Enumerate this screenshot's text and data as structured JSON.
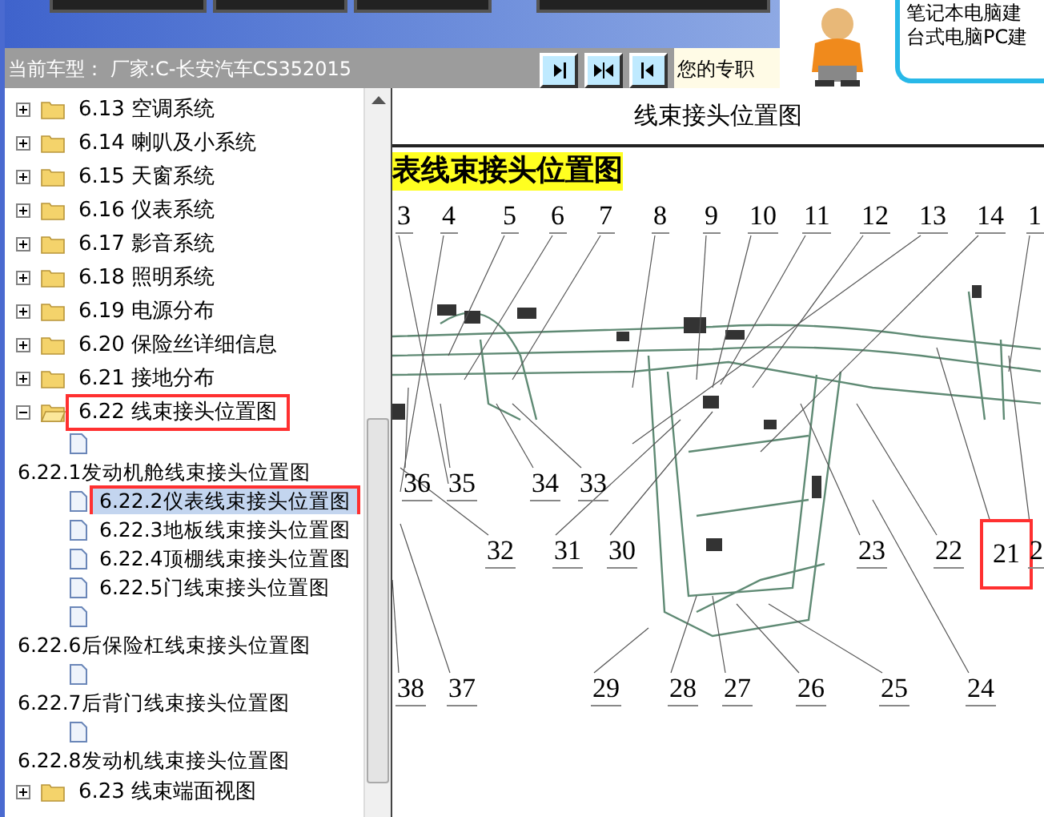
{
  "vehicle_bar": {
    "label": "当前车型：",
    "value": "厂家:C-长安汽车CS352015",
    "view_buttons": [
      {
        "kind": "right"
      },
      {
        "kind": "split"
      },
      {
        "kind": "left"
      }
    ],
    "notice": "您的专职"
  },
  "ad": {
    "lines": [
      "笔记本电脑建",
      "台式电脑PC建"
    ]
  },
  "tree": [
    {
      "kind": "folder",
      "label": "6.13 空调系统",
      "expanded": false,
      "annotated": false
    },
    {
      "kind": "folder",
      "label": "6.14 喇叭及小系统",
      "expanded": false,
      "annotated": false
    },
    {
      "kind": "folder",
      "label": "6.15 天窗系统",
      "expanded": false,
      "annotated": false
    },
    {
      "kind": "folder",
      "label": "6.16 仪表系统",
      "expanded": false,
      "annotated": false
    },
    {
      "kind": "folder",
      "label": "6.17 影音系统",
      "expanded": false,
      "annotated": false
    },
    {
      "kind": "folder",
      "label": "6.18 照明系统",
      "expanded": false,
      "annotated": false
    },
    {
      "kind": "folder",
      "label": "6.19 电源分布",
      "expanded": false,
      "annotated": false
    },
    {
      "kind": "folder",
      "label": "6.20 保险丝详细信息",
      "expanded": false,
      "annotated": false
    },
    {
      "kind": "folder",
      "label": "6.21 接地分布",
      "expanded": false,
      "annotated": false
    },
    {
      "kind": "folder",
      "label": "6.22 线束接头位置图",
      "expanded": true,
      "annotated": true,
      "children": [
        {
          "kind": "doc"
        },
        {
          "kind": "group",
          "label": "6.22.1发动机舱线束接头位置图",
          "children": [
            {
              "kind": "doc",
              "label": "6.22.2仪表线束接头位置图",
              "selected": true,
              "annotated": true
            },
            {
              "kind": "doc",
              "label": "6.22.3地板线束接头位置图",
              "selected": false,
              "annotated": false
            },
            {
              "kind": "doc",
              "label": "6.22.4顶棚线束接头位置图",
              "selected": false,
              "annotated": false
            },
            {
              "kind": "doc",
              "label": "6.22.5门线束接头位置图",
              "selected": false,
              "annotated": false
            },
            {
              "kind": "doc"
            }
          ]
        },
        {
          "kind": "group",
          "label": "6.22.6后保险杠线束接头位置图",
          "children": [
            {
              "kind": "doc"
            }
          ]
        },
        {
          "kind": "group",
          "label": "6.22.7后背门线束接头位置图",
          "children": [
            {
              "kind": "doc"
            }
          ]
        },
        {
          "kind": "group",
          "label": "6.22.8发动机线束接头位置图"
        }
      ]
    },
    {
      "kind": "folder",
      "label": "6.23 线束端面视图",
      "expanded": false,
      "annotated": false
    }
  ],
  "document": {
    "title": "线束接头位置图",
    "section_heading": "表线束接头位置图",
    "callouts": [
      {
        "label": "3",
        "marked": false
      },
      {
        "label": "4",
        "marked": false
      },
      {
        "label": "5",
        "marked": false
      },
      {
        "label": "6",
        "marked": false
      },
      {
        "label": "7",
        "marked": false
      },
      {
        "label": "8",
        "marked": false
      },
      {
        "label": "9",
        "marked": false
      },
      {
        "label": "10",
        "marked": false
      },
      {
        "label": "11",
        "marked": false
      },
      {
        "label": "12",
        "marked": false
      },
      {
        "label": "13",
        "marked": false
      },
      {
        "label": "14",
        "marked": false
      },
      {
        "label": "1",
        "marked": false
      },
      {
        "label": "36",
        "marked": false
      },
      {
        "label": "35",
        "marked": false
      },
      {
        "label": "34",
        "marked": false
      },
      {
        "label": "33",
        "marked": false
      },
      {
        "label": "32",
        "marked": false
      },
      {
        "label": "31",
        "marked": false
      },
      {
        "label": "30",
        "marked": false
      },
      {
        "label": "23",
        "marked": false
      },
      {
        "label": "22",
        "marked": false
      },
      {
        "label": "21",
        "marked": true
      },
      {
        "label": "2",
        "marked": false
      },
      {
        "label": "38",
        "marked": false
      },
      {
        "label": "37",
        "marked": false
      },
      {
        "label": "29",
        "marked": false
      },
      {
        "label": "28",
        "marked": false
      },
      {
        "label": "27",
        "marked": false
      },
      {
        "label": "26",
        "marked": false
      },
      {
        "label": "25",
        "marked": false
      },
      {
        "label": "24",
        "marked": false
      }
    ]
  }
}
